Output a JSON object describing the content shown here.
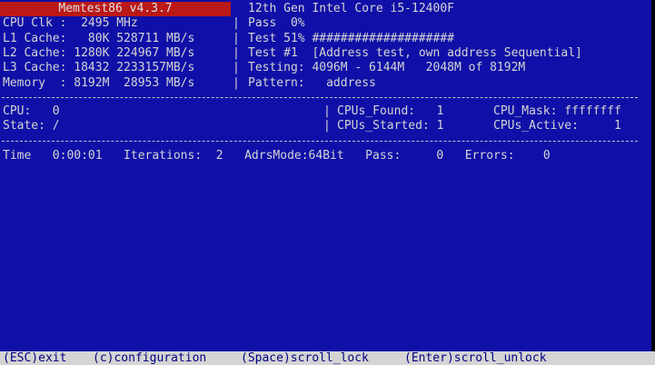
{
  "title": "Memtest86 v4.3.7",
  "cpu_model": "12th Gen Intel Core i5-12400F",
  "system_lines": [
    "CPU Clk :  2495 MHz",
    "L1 Cache:   80K 528711 MB/s",
    "L2 Cache: 1280K 224967 MB/s",
    "L3 Cache: 18432 2233157MB/s",
    "Memory  : 8192M  28953 MB/s"
  ],
  "test_lines": [
    "Pass  0%",
    "Test 51% ####################",
    "Test #1  [Address test, own address Sequential]",
    "Testing: 4096M - 6144M   2048M of 8192M",
    "Pattern:   address"
  ],
  "cpu_block": {
    "cpu_label": "CPU:   0",
    "state_label": "State: /",
    "cpus_found": "CPUs_Found:   1",
    "cpu_mask": "CPU_Mask: ffffffff",
    "cpus_started": "CPUs_Started: 1",
    "cpus_active": "CPUs_Active:     1"
  },
  "status_line": "Time   0:00:01   Iterations:  2   AdrsMode:64Bit   Pass:     0   Errors:    0",
  "bottom_bar": {
    "esc": "(ESC)exit",
    "config": "(c)configuration",
    "scroll_lock": "(Space)scroll_lock",
    "scroll_unlock": "(Enter)scroll_unlock"
  },
  "colors": {
    "background": "#1010a8",
    "title_bar": "#bb1818",
    "text": "#d4d4d4",
    "bottom_bar": "#d4d4d4",
    "bottom_text": "#000080"
  }
}
